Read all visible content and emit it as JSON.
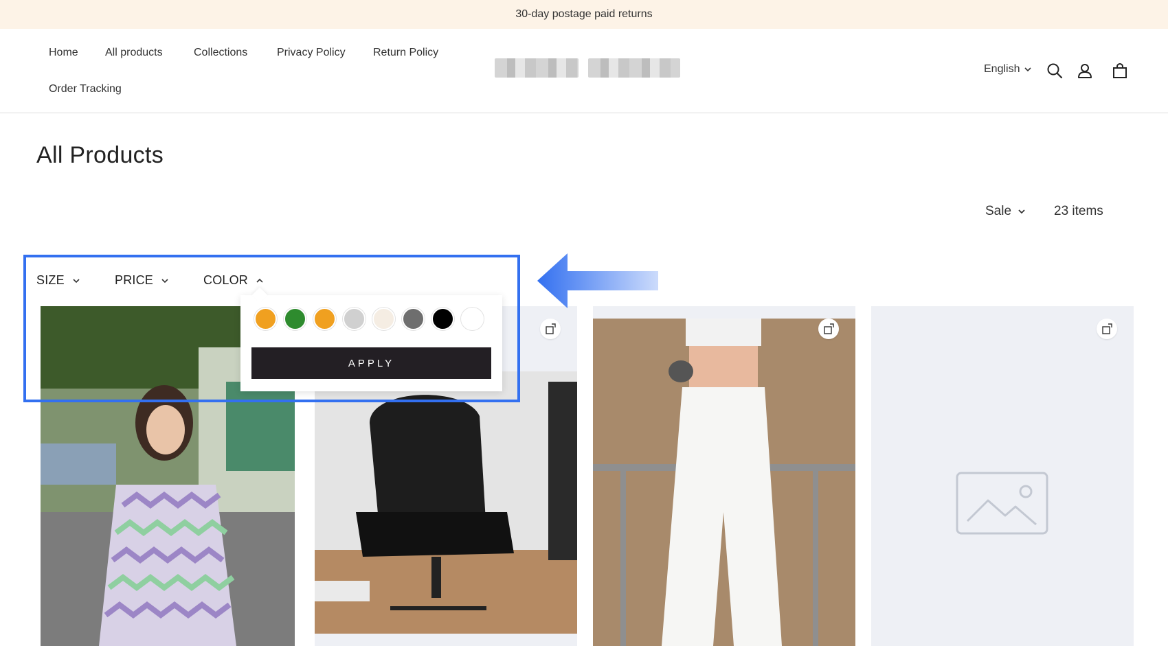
{
  "announcement": "30-day postage paid returns",
  "nav": {
    "items": [
      "Home",
      "All products",
      "Collections",
      "Privacy Policy",
      "Return Policy",
      "Order Tracking"
    ]
  },
  "header": {
    "language": "English",
    "icons": [
      "search-icon",
      "account-icon",
      "cart-icon"
    ]
  },
  "page": {
    "title": "All Products",
    "sort_label": "Sale",
    "item_count": "23 items"
  },
  "filters": {
    "size": "SIZE",
    "price": "PRICE",
    "color": "COLOR"
  },
  "color_popup": {
    "swatches": [
      "#f0a020",
      "#2e8b2e",
      "#f0a020",
      "#d0d0d0",
      "#f5ede3",
      "#6e6e6e",
      "#000000",
      "#ffffff"
    ],
    "apply_label": "APPLY"
  },
  "products": [
    {
      "image": "woman in zigzag knit cardigan"
    },
    {
      "image": "black leather office chair"
    },
    {
      "image": "white wide-leg trousers"
    },
    {
      "image": "placeholder image"
    }
  ],
  "annotation": {
    "highlight_color": "#3370f0"
  }
}
